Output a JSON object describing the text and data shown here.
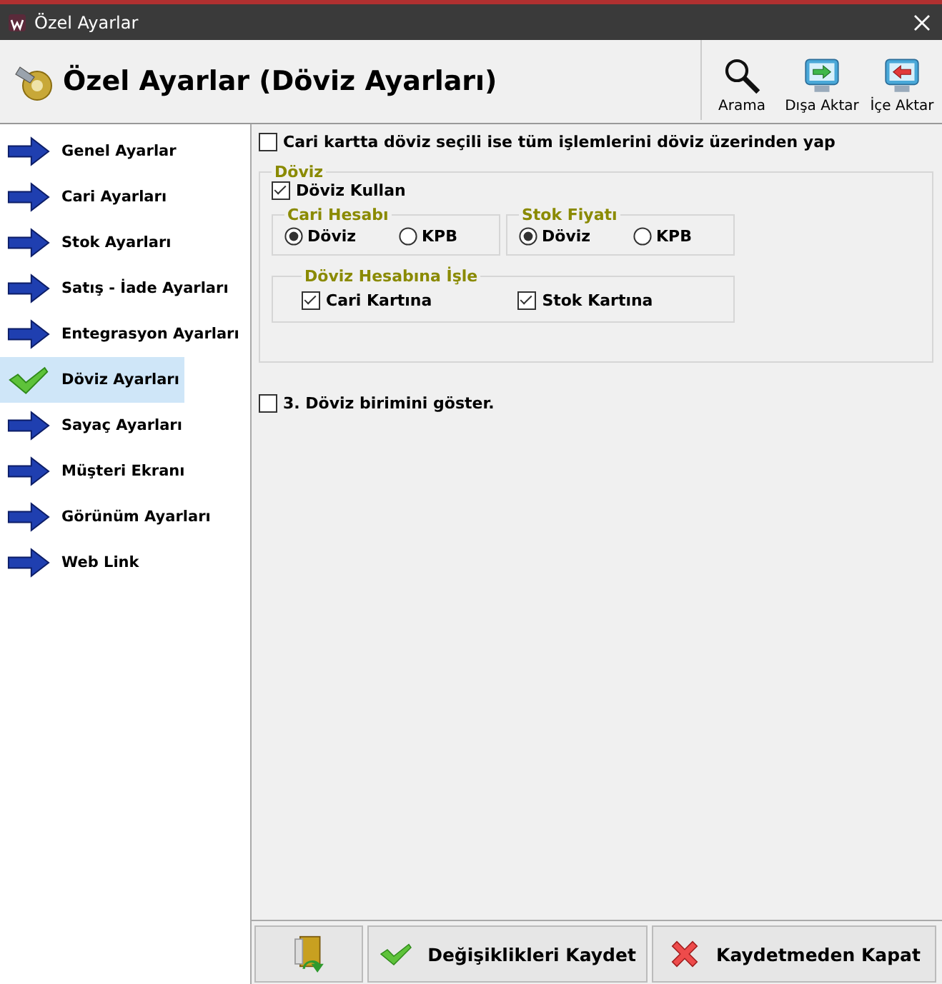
{
  "window": {
    "title": "Özel Ayarlar"
  },
  "header": {
    "title": "Özel Ayarlar (Döviz Ayarları)"
  },
  "toolbar": [
    {
      "label": "Arama",
      "kind": "search"
    },
    {
      "label": "Dışa Aktar",
      "kind": "export"
    },
    {
      "label": "İçe Aktar",
      "kind": "import"
    }
  ],
  "sidebar": {
    "items": [
      {
        "label": "Genel Ayarlar",
        "selected": false
      },
      {
        "label": "Cari Ayarları",
        "selected": false
      },
      {
        "label": "Stok Ayarları",
        "selected": false
      },
      {
        "label": "Satış - İade Ayarları",
        "selected": false
      },
      {
        "label": "Entegrasyon Ayarları",
        "selected": false
      },
      {
        "label": "Döviz Ayarları",
        "selected": true
      },
      {
        "label": "Sayaç Ayarları",
        "selected": false
      },
      {
        "label": "Müşteri Ekranı",
        "selected": false
      },
      {
        "label": "Görünüm Ayarları",
        "selected": false
      },
      {
        "label": "Web Link",
        "selected": false
      }
    ]
  },
  "settings": {
    "all_in_currency": {
      "label": "Cari kartta döviz seçili ise tüm işlemlerini döviz üzerinden yap",
      "checked": false
    },
    "currency_group": {
      "title": "Döviz",
      "use": {
        "label": "Döviz Kullan",
        "checked": true
      },
      "radio_groups": [
        {
          "title": "Cari Hesabı",
          "options": [
            {
              "label": "Döviz",
              "selected": true
            },
            {
              "label": "KPB",
              "selected": false
            }
          ]
        },
        {
          "title": "Stok Fiyatı",
          "options": [
            {
              "label": "Döviz",
              "selected": true
            },
            {
              "label": "KPB",
              "selected": false
            }
          ]
        }
      ],
      "post_group": {
        "title": "Döviz Hesabına İşle",
        "options": [
          {
            "label": "Cari Kartına",
            "checked": true
          },
          {
            "label": "Stok Kartına",
            "checked": true
          }
        ]
      }
    },
    "third_currency": {
      "label": "3. Döviz birimini göster.",
      "checked": false
    }
  },
  "buttons": [
    {
      "kind": "exit"
    },
    {
      "kind": "save",
      "label": "Değişiklikleri Kaydet"
    },
    {
      "kind": "close",
      "label": "Kaydetmeden Kapat"
    }
  ]
}
